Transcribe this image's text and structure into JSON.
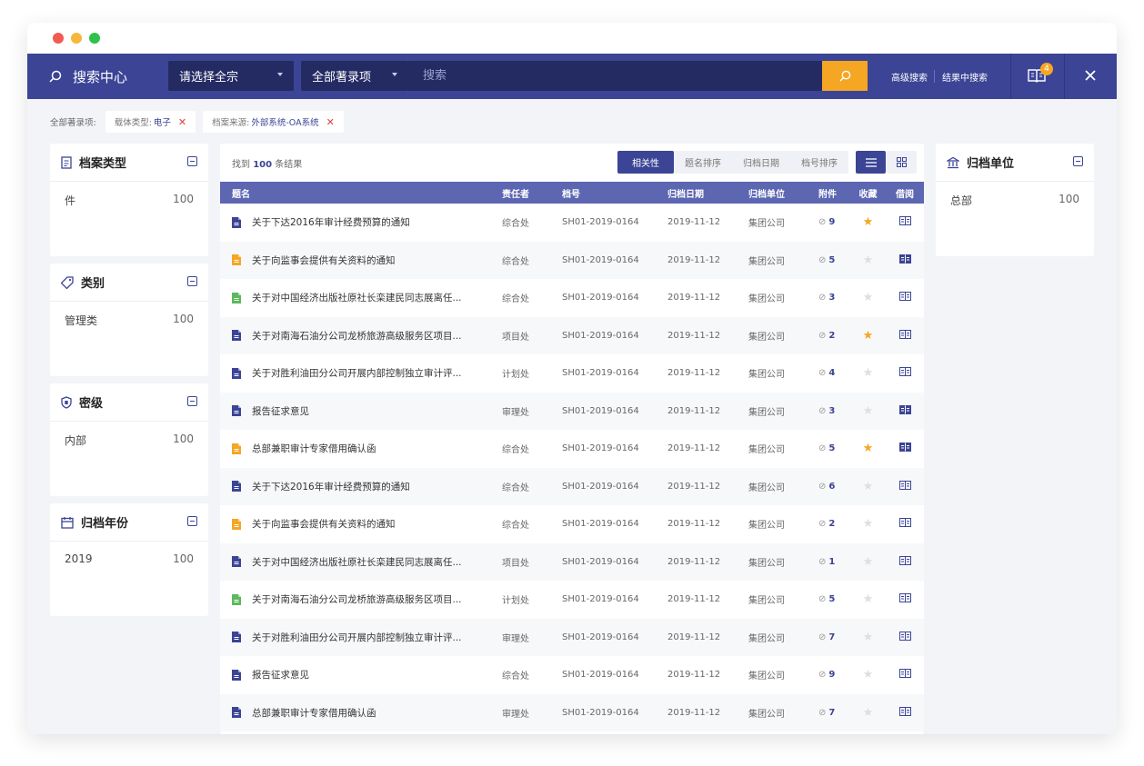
{
  "header": {
    "title": "搜索中心",
    "fonds_select": "请选择全宗",
    "field_select": "全部著录项",
    "search_placeholder": "搜索",
    "advanced_search": "高级搜索",
    "search_in_results": "结果中搜索",
    "borrow_count": "4"
  },
  "filters": {
    "label": "全部著录项:",
    "chips": [
      {
        "key": "载体类型:",
        "value": "电子"
      },
      {
        "key": "档案来源:",
        "value": "外部系统-OA系统"
      }
    ]
  },
  "facets": {
    "archive_type": {
      "title": "档案类型",
      "items": [
        {
          "label": "件",
          "count": "100"
        }
      ]
    },
    "category": {
      "title": "类别",
      "items": [
        {
          "label": "管理类",
          "count": "100"
        }
      ]
    },
    "security": {
      "title": "密级",
      "items": [
        {
          "label": "内部",
          "count": "100"
        }
      ]
    },
    "archive_year": {
      "title": "归档年份",
      "items": [
        {
          "label": "2019",
          "count": "100"
        }
      ]
    },
    "archive_unit": {
      "title": "归档单位",
      "items": [
        {
          "label": "总部",
          "count": "100"
        }
      ]
    }
  },
  "results": {
    "found_prefix": "找到",
    "found_count": "100",
    "found_suffix": "条结果",
    "sort_tabs": [
      "相关性",
      "题名排序",
      "归档日期",
      "档号排序"
    ],
    "columns": [
      "题名",
      "责任者",
      "档号",
      "归档日期",
      "归档单位",
      "附件",
      "收藏",
      "借阅"
    ],
    "rows": [
      {
        "icon": "doc",
        "title": "关于下达2016年审计经费预算的通知",
        "owner": "综合处",
        "code": "SH01-2019-0164",
        "date": "2019-11-12",
        "unit": "集团公司",
        "attachments": "9",
        "starred": true,
        "borrowed": false
      },
      {
        "icon": "pdf",
        "title": "关于向监事会提供有关资料的通知",
        "owner": "综合处",
        "code": "SH01-2019-0164",
        "date": "2019-11-12",
        "unit": "集团公司",
        "attachments": "5",
        "starred": false,
        "borrowed": true
      },
      {
        "icon": "xls",
        "title": "关于对中国经济出版社原社长栾建民同志展离任...",
        "owner": "综合处",
        "code": "SH01-2019-0164",
        "date": "2019-11-12",
        "unit": "集团公司",
        "attachments": "3",
        "starred": false,
        "borrowed": false
      },
      {
        "icon": "doc",
        "title": "关于对南海石油分公司龙桥旅游高级服务区项目...",
        "owner": "项目处",
        "code": "SH01-2019-0164",
        "date": "2019-11-12",
        "unit": "集团公司",
        "attachments": "2",
        "starred": true,
        "borrowed": false
      },
      {
        "icon": "doc",
        "title": "关于对胜利油田分公司开展内部控制独立审计评...",
        "owner": "计划处",
        "code": "SH01-2019-0164",
        "date": "2019-11-12",
        "unit": "集团公司",
        "attachments": "4",
        "starred": false,
        "borrowed": false
      },
      {
        "icon": "doc",
        "title": "报告征求意见",
        "owner": "审理处",
        "code": "SH01-2019-0164",
        "date": "2019-11-12",
        "unit": "集团公司",
        "attachments": "3",
        "starred": false,
        "borrowed": true
      },
      {
        "icon": "pdf",
        "title": "总部兼职审计专家借用确认函",
        "owner": "综合处",
        "code": "SH01-2019-0164",
        "date": "2019-11-12",
        "unit": "集团公司",
        "attachments": "5",
        "starred": true,
        "borrowed": true
      },
      {
        "icon": "doc",
        "title": "关于下达2016年审计经费预算的通知",
        "owner": "综合处",
        "code": "SH01-2019-0164",
        "date": "2019-11-12",
        "unit": "集团公司",
        "attachments": "6",
        "starred": false,
        "borrowed": false
      },
      {
        "icon": "pdf",
        "title": "关于向监事会提供有关资料的通知",
        "owner": "综合处",
        "code": "SH01-2019-0164",
        "date": "2019-11-12",
        "unit": "集团公司",
        "attachments": "2",
        "starred": false,
        "borrowed": false
      },
      {
        "icon": "doc",
        "title": "关于对中国经济出版社原社长栾建民同志展离任...",
        "owner": "项目处",
        "code": "SH01-2019-0164",
        "date": "2019-11-12",
        "unit": "集团公司",
        "attachments": "1",
        "starred": false,
        "borrowed": false
      },
      {
        "icon": "xls",
        "title": "关于对南海石油分公司龙桥旅游高级服务区项目...",
        "owner": "计划处",
        "code": "SH01-2019-0164",
        "date": "2019-11-12",
        "unit": "集团公司",
        "attachments": "5",
        "starred": false,
        "borrowed": false
      },
      {
        "icon": "doc",
        "title": "关于对胜利油田分公司开展内部控制独立审计评...",
        "owner": "审理处",
        "code": "SH01-2019-0164",
        "date": "2019-11-12",
        "unit": "集团公司",
        "attachments": "7",
        "starred": false,
        "borrowed": false
      },
      {
        "icon": "doc",
        "title": "报告征求意见",
        "owner": "综合处",
        "code": "SH01-2019-0164",
        "date": "2019-11-12",
        "unit": "集团公司",
        "attachments": "9",
        "starred": false,
        "borrowed": false
      },
      {
        "icon": "doc",
        "title": "总部兼职审计专家借用确认函",
        "owner": "审理处",
        "code": "SH01-2019-0164",
        "date": "2019-11-12",
        "unit": "集团公司",
        "attachments": "7",
        "starred": false,
        "borrowed": false
      }
    ]
  },
  "colors": {
    "primary": "#3b4495",
    "primary_dark": "#242b63",
    "accent": "#f5a623",
    "doc_icon": "#3b4495",
    "pdf_icon": "#f5a623",
    "xls_icon": "#5cb85c"
  },
  "icons": {
    "search": "search-icon",
    "borrow": "book-icon",
    "close": "close-icon",
    "attachment": "paperclip-icon",
    "favorite": "star-icon",
    "collapse": "minus-square-icon"
  }
}
